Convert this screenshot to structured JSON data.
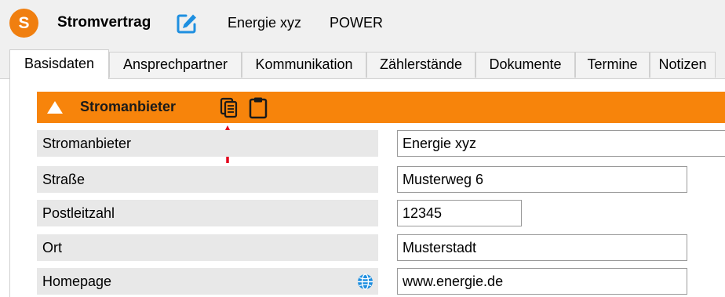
{
  "header": {
    "logo_letter": "S",
    "title": "Stromvertrag",
    "company": "Energie xyz",
    "product": "POWER"
  },
  "tabs": [
    {
      "label": "Basisdaten",
      "active": true
    },
    {
      "label": "Ansprechpartner"
    },
    {
      "label": "Kommunikation"
    },
    {
      "label": "Zählerstände"
    },
    {
      "label": "Dokumente"
    },
    {
      "label": "Termine"
    },
    {
      "label": "Notizen"
    }
  ],
  "section": {
    "title": "Stromanbieter",
    "icons": [
      "collapse-triangle-icon",
      "copy-icon",
      "clipboard-icon"
    ],
    "accent_color": "#f7840b"
  },
  "fields": [
    {
      "label": "Stromanbieter",
      "value": "Energie xyz"
    },
    {
      "label": "Straße",
      "value": "Musterweg 6"
    },
    {
      "label": "Postleitzahl",
      "value": "12345"
    },
    {
      "label": "Ort",
      "value": "Musterstadt"
    },
    {
      "label": "Homepage",
      "value": "www.energie.de",
      "icon": "globe-icon"
    }
  ],
  "colors": {
    "brand": "#f07f10",
    "edit_icon": "#1e8fe0",
    "arrow": "#e3001b",
    "globe": "#1e8fe0"
  }
}
